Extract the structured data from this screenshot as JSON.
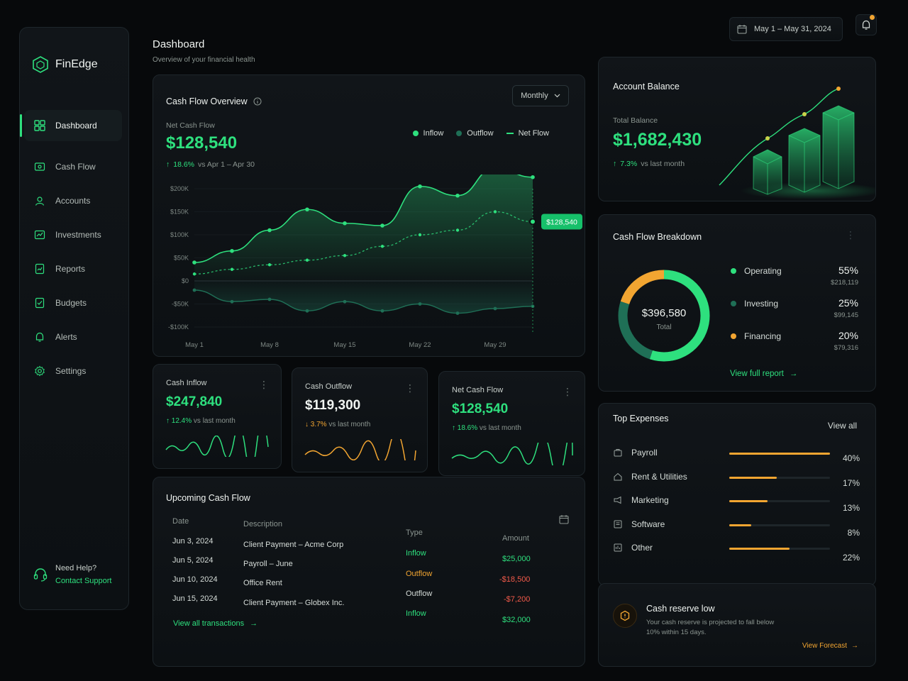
{
  "app": {
    "name": "FinEdge"
  },
  "sidebar": {
    "items": [
      {
        "label": "Dashboard",
        "icon": "dashboard-icon"
      },
      {
        "label": "Cash Flow",
        "icon": "cash-flow-icon"
      },
      {
        "label": "Accounts",
        "icon": "accounts-icon"
      },
      {
        "label": "Investments",
        "icon": "investments-icon"
      },
      {
        "label": "Reports",
        "icon": "reports-icon"
      },
      {
        "label": "Budgets",
        "icon": "budgets-icon"
      },
      {
        "label": "Alerts",
        "icon": "bell-icon"
      },
      {
        "label": "Settings",
        "icon": "gear-icon"
      }
    ],
    "help_title": "Need Help?",
    "help_link": "Contact Support"
  },
  "header": {
    "title": "Dashboard",
    "subtitle": "Overview of your financial health",
    "date_range": "May 1 – May 31, 2024"
  },
  "cash_flow_overview": {
    "title": "Cash Flow Overview",
    "period_select": "Monthly",
    "net_label": "Net Cash Flow",
    "net_value": "$128,540",
    "change_pct": "18.6%",
    "change_text": "vs Apr 1 – Apr 30",
    "legend": [
      "Inflow",
      "Outflow",
      "Net Flow"
    ],
    "tooltip": "$128,540"
  },
  "chart_data": {
    "type": "area",
    "x": [
      "May 1",
      "May 4",
      "May 8",
      "May 11",
      "May 15",
      "May 18",
      "May 22",
      "May 25",
      "May 29",
      "May 31"
    ],
    "x_ticks": [
      "May 1",
      "May 8",
      "May 15",
      "May 22",
      "May 29"
    ],
    "y_ticks": [
      "$200K",
      "$150K",
      "$100K",
      "$50K",
      "$0",
      "-$50K",
      "-$100K"
    ],
    "ylim": [
      -100000,
      200000
    ],
    "series": [
      {
        "name": "Inflow",
        "values": [
          40000,
          65000,
          110000,
          155000,
          125000,
          120000,
          205000,
          185000,
          245000,
          225000
        ]
      },
      {
        "name": "Outflow",
        "values": [
          -20000,
          -45000,
          -40000,
          -65000,
          -45000,
          -65000,
          -50000,
          -70000,
          -60000,
          -55000
        ]
      },
      {
        "name": "Net Flow",
        "values": [
          15000,
          25000,
          35000,
          45000,
          55000,
          75000,
          100000,
          110000,
          150000,
          128540
        ]
      }
    ],
    "colors": {
      "inflow": "#2ee07e",
      "outflow": "#1f6f56",
      "net": "#2ee07e"
    }
  },
  "stats": [
    {
      "label": "Cash Inflow",
      "value": "$247,840",
      "change": "12.4%",
      "change_text": "vs last month",
      "trend": "up"
    },
    {
      "label": "Cash Outflow",
      "value": "$119,300",
      "change": "3.7%",
      "change_text": "vs last month",
      "trend": "down"
    },
    {
      "label": "Net Cash Flow",
      "value": "$128,540",
      "change": "18.6%",
      "change_text": "vs last month",
      "trend": "up"
    }
  ],
  "upcoming": {
    "title": "Upcoming Cash Flow",
    "columns": [
      "Date",
      "Description",
      "Type",
      "Amount"
    ],
    "rows": [
      {
        "date": "Jun 3, 2024",
        "description": "Client Payment – Acme Corp",
        "type": "Inflow",
        "amount": "$25,000"
      },
      {
        "date": "Jun 5, 2024",
        "description": "Payroll – June",
        "type": "Outflow",
        "amount": "-$18,500"
      },
      {
        "date": "Jun 10, 2024",
        "description": "Office Rent",
        "type": "Outflow",
        "amount": "-$7,200"
      },
      {
        "date": "Jun 15, 2024",
        "description": "Client Payment – Globex Inc.",
        "type": "Inflow",
        "amount": "$32,000"
      }
    ],
    "view_all": "View all transactions"
  },
  "balance": {
    "title": "Account Balance",
    "label": "Total Balance",
    "value": "$1,682,430",
    "change": "7.3%",
    "change_text": "vs last month"
  },
  "breakdown": {
    "title": "Cash Flow Breakdown",
    "total": "$396,580",
    "total_label": "Total",
    "items": [
      {
        "name": "Operating",
        "pct": "55%",
        "amount": "$218,119",
        "color": "#2ee07e",
        "share": 0.55
      },
      {
        "name": "Investing",
        "pct": "25%",
        "amount": "$99,145",
        "color": "#1f6f56",
        "share": 0.25
      },
      {
        "name": "Financing",
        "pct": "20%",
        "amount": "$79,316",
        "color": "#f2a531",
        "share": 0.2
      }
    ],
    "view_report": "View full report"
  },
  "expenses": {
    "title": "Top Expenses",
    "view_all": "View all",
    "items": [
      {
        "name": "Payroll",
        "pct": "40%",
        "share": 1.0,
        "icon": "payroll-icon"
      },
      {
        "name": "Rent & Utilities",
        "pct": "17%",
        "share": 0.47,
        "icon": "rent-icon"
      },
      {
        "name": "Marketing",
        "pct": "13%",
        "share": 0.38,
        "icon": "marketing-icon"
      },
      {
        "name": "Software",
        "pct": "8%",
        "share": 0.22,
        "icon": "software-icon"
      },
      {
        "name": "Other",
        "pct": "22%",
        "share": 0.6,
        "icon": "other-icon"
      }
    ]
  },
  "alert": {
    "title": "Cash reserve low",
    "body": "Your cash reserve is projected to fall below 10% within 15 days.",
    "action": "View Forecast"
  }
}
